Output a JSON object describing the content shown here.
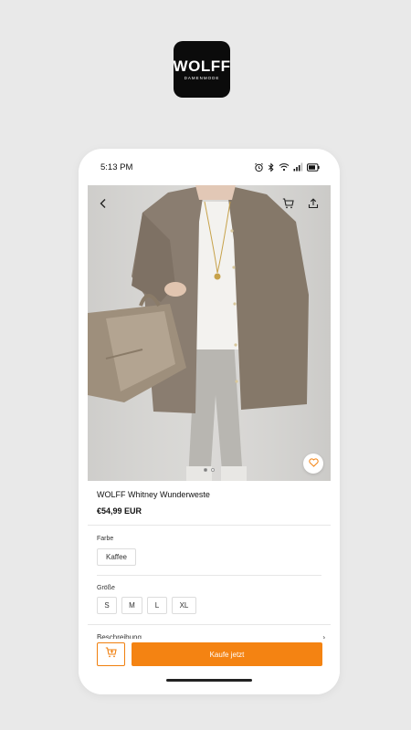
{
  "brand": {
    "name": "WOLFF",
    "subtitle": "DAMENMODE"
  },
  "status_bar": {
    "time": "5:13 PM"
  },
  "product": {
    "title": "WOLFF Whitney Wunderweste",
    "price": "€54,99 EUR"
  },
  "options": {
    "color": {
      "label": "Farbe",
      "values": [
        "Kaffee"
      ]
    },
    "size": {
      "label": "Größe",
      "values": [
        "S",
        "M",
        "L",
        "XL"
      ]
    }
  },
  "partial_row": {
    "label": "Beschreibung"
  },
  "carousel": {
    "count": 2,
    "active": 1
  },
  "actions": {
    "buy_label": "Kaufe jetzt"
  },
  "colors": {
    "accent": "#f48312",
    "logo_bg": "#0b0b0b",
    "page_bg": "#e9e9e9"
  }
}
